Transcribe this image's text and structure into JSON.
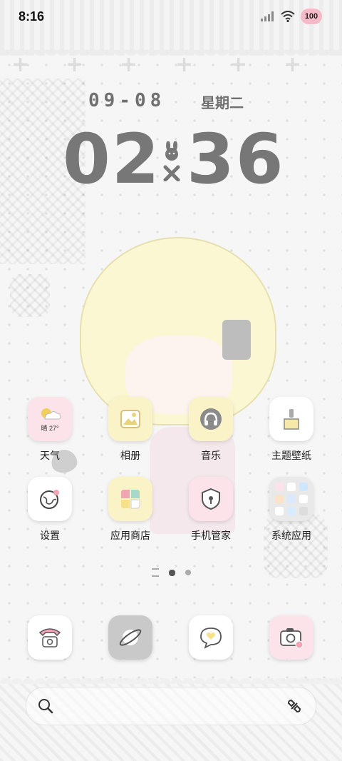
{
  "status_bar": {
    "time": "8:16",
    "battery": "100"
  },
  "lockclock": {
    "date": "09-08",
    "weekday": "星期二",
    "hour": "02",
    "minute": "36"
  },
  "apps": [
    {
      "label": "天气",
      "badge": "晴 27°",
      "icon": "weather-icon"
    },
    {
      "label": "相册",
      "icon": "gallery-icon"
    },
    {
      "label": "音乐",
      "icon": "music-icon"
    },
    {
      "label": "主题壁纸",
      "icon": "theme-brush-icon"
    },
    {
      "label": "设置",
      "icon": "settings-globe-icon"
    },
    {
      "label": "应用商店",
      "icon": "app-store-icon"
    },
    {
      "label": "手机管家",
      "icon": "phone-manager-icon"
    },
    {
      "label": "系统应用",
      "icon": "system-apps-folder-icon"
    }
  ],
  "dock": [
    {
      "icon": "phone-icon"
    },
    {
      "icon": "browser-planet-icon"
    },
    {
      "icon": "messages-icon"
    },
    {
      "icon": "camera-icon"
    }
  ],
  "page_indicator": {
    "pages": 2,
    "current": 1
  },
  "colors": {
    "accent_pink": "#f6b9c7",
    "accent_yellow": "#fbf3c8",
    "text_grey": "#777777"
  }
}
